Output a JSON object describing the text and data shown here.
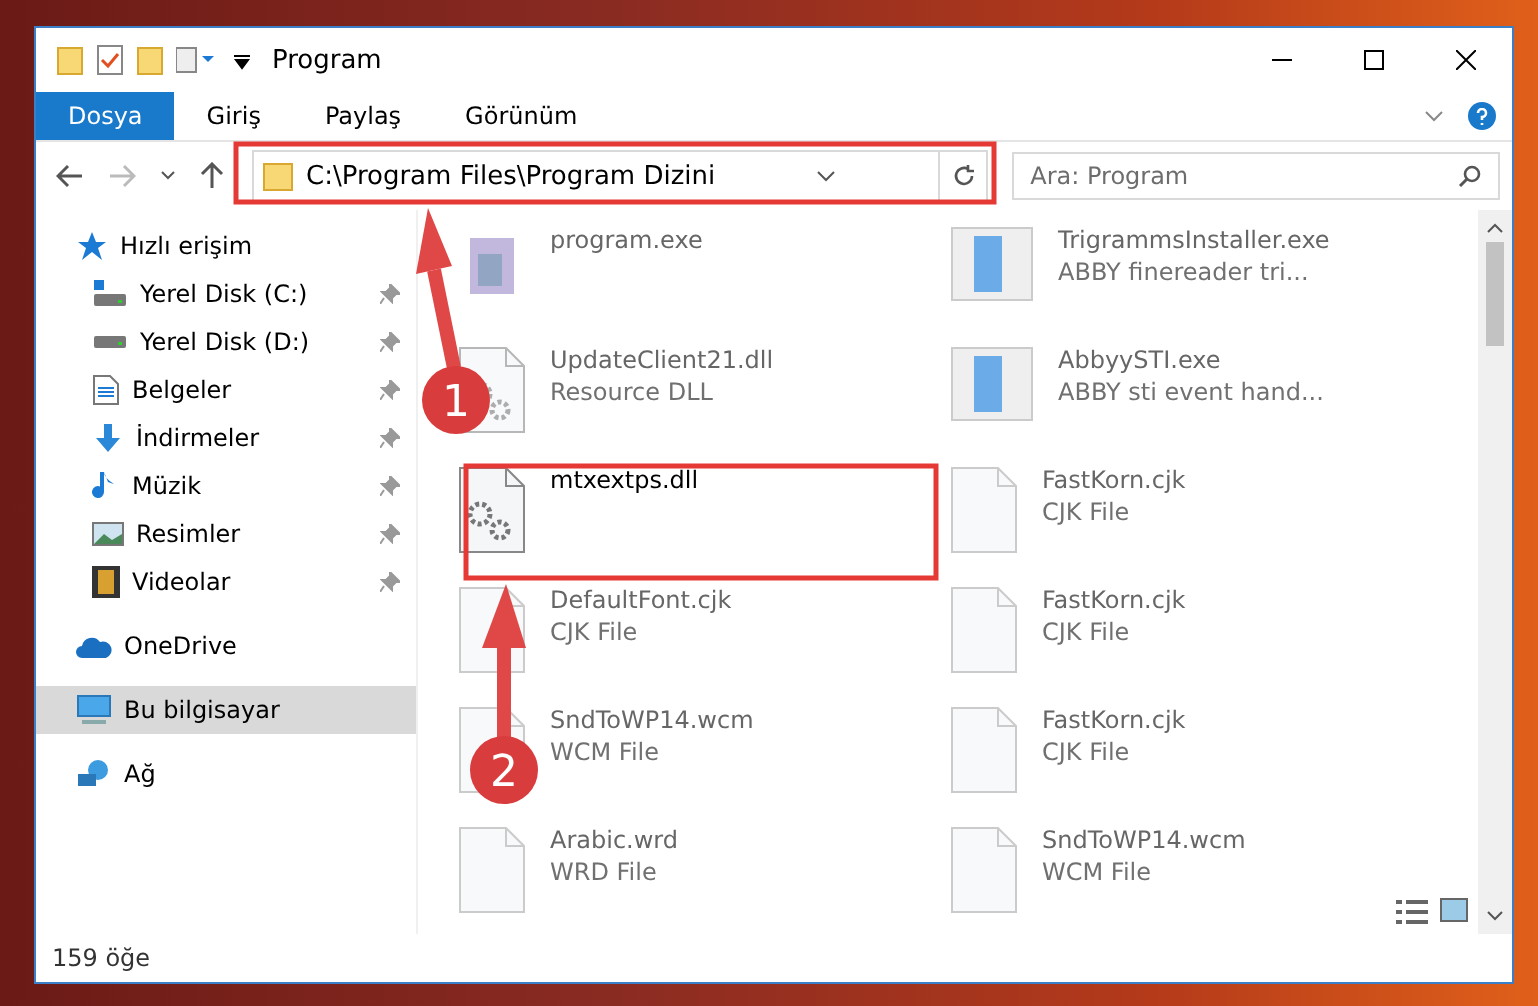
{
  "window": {
    "title": "Program"
  },
  "ribbon_tabs": [
    {
      "label": "Dosya",
      "selected": true
    },
    {
      "label": "Giriş",
      "selected": false
    },
    {
      "label": "Paylaş",
      "selected": false
    },
    {
      "label": "Görünüm",
      "selected": false
    }
  ],
  "address": {
    "path": "C:\\Program Files\\Program Dizini"
  },
  "search": {
    "placeholder": "Ara: Program"
  },
  "sidebar": {
    "items": [
      {
        "label": "Hızlı erişim",
        "kind": "quick",
        "selected": false,
        "children": [
          {
            "label": "Yerel Disk (C:)",
            "kind": "disk-c",
            "pinned": true,
            "selected": false
          },
          {
            "label": "Yerel Disk (D:)",
            "kind": "disk",
            "pinned": true,
            "selected": false
          },
          {
            "label": "Belgeler",
            "kind": "docs",
            "pinned": true,
            "selected": false
          },
          {
            "label": "İndirmeler",
            "kind": "download",
            "pinned": true,
            "selected": false
          },
          {
            "label": "Müzik",
            "kind": "music",
            "pinned": true,
            "selected": false
          },
          {
            "label": "Resimler",
            "kind": "pictures",
            "pinned": true,
            "selected": false
          },
          {
            "label": "Videolar",
            "kind": "videos",
            "pinned": true,
            "selected": false
          }
        ]
      },
      {
        "label": "OneDrive",
        "kind": "cloud",
        "selected": false
      },
      {
        "label": "Bu bilgisayar",
        "kind": "pc",
        "selected": true
      },
      {
        "label": "Ağ",
        "kind": "network",
        "selected": false
      }
    ]
  },
  "files": [
    {
      "name": "program.exe",
      "kind": "exe",
      "blurred": true
    },
    {
      "name": "TrigrammsInstaller.exe",
      "description": "ABBY finereader tri...",
      "kind": "app",
      "blurred": true
    },
    {
      "name": "UpdateClient21.dll",
      "description": "Resource DLL",
      "kind": "dll",
      "blurred": true
    },
    {
      "name": "AbbyySTI.exe",
      "description": "ABBY sti event hand...",
      "kind": "app",
      "blurred": true
    },
    {
      "name": "mtxextps.dll",
      "kind": "dll",
      "blurred": false
    },
    {
      "name": "FastKorn.cjk",
      "description": "CJK File",
      "kind": "file",
      "blurred": true
    },
    {
      "name": "DefaultFont.cjk",
      "description": "CJK File",
      "kind": "file",
      "blurred": true
    },
    {
      "name": "FastKorn.cjk",
      "description": "CJK File",
      "kind": "file",
      "blurred": true
    },
    {
      "name": "SndToWP14.wcm",
      "description": "WCM File",
      "kind": "file",
      "blurred": true
    },
    {
      "name": "FastKorn.cjk",
      "description": "CJK File",
      "kind": "file",
      "blurred": true
    },
    {
      "name": "Arabic.wrd",
      "description": "WRD File",
      "kind": "file",
      "blurred": true
    },
    {
      "name": "SndToWP14.wcm",
      "description": "WCM File",
      "kind": "file",
      "blurred": true
    }
  ],
  "status_bar": {
    "count": "159 öğe"
  },
  "callouts": [
    {
      "label": "1"
    },
    {
      "label": "2"
    }
  ]
}
